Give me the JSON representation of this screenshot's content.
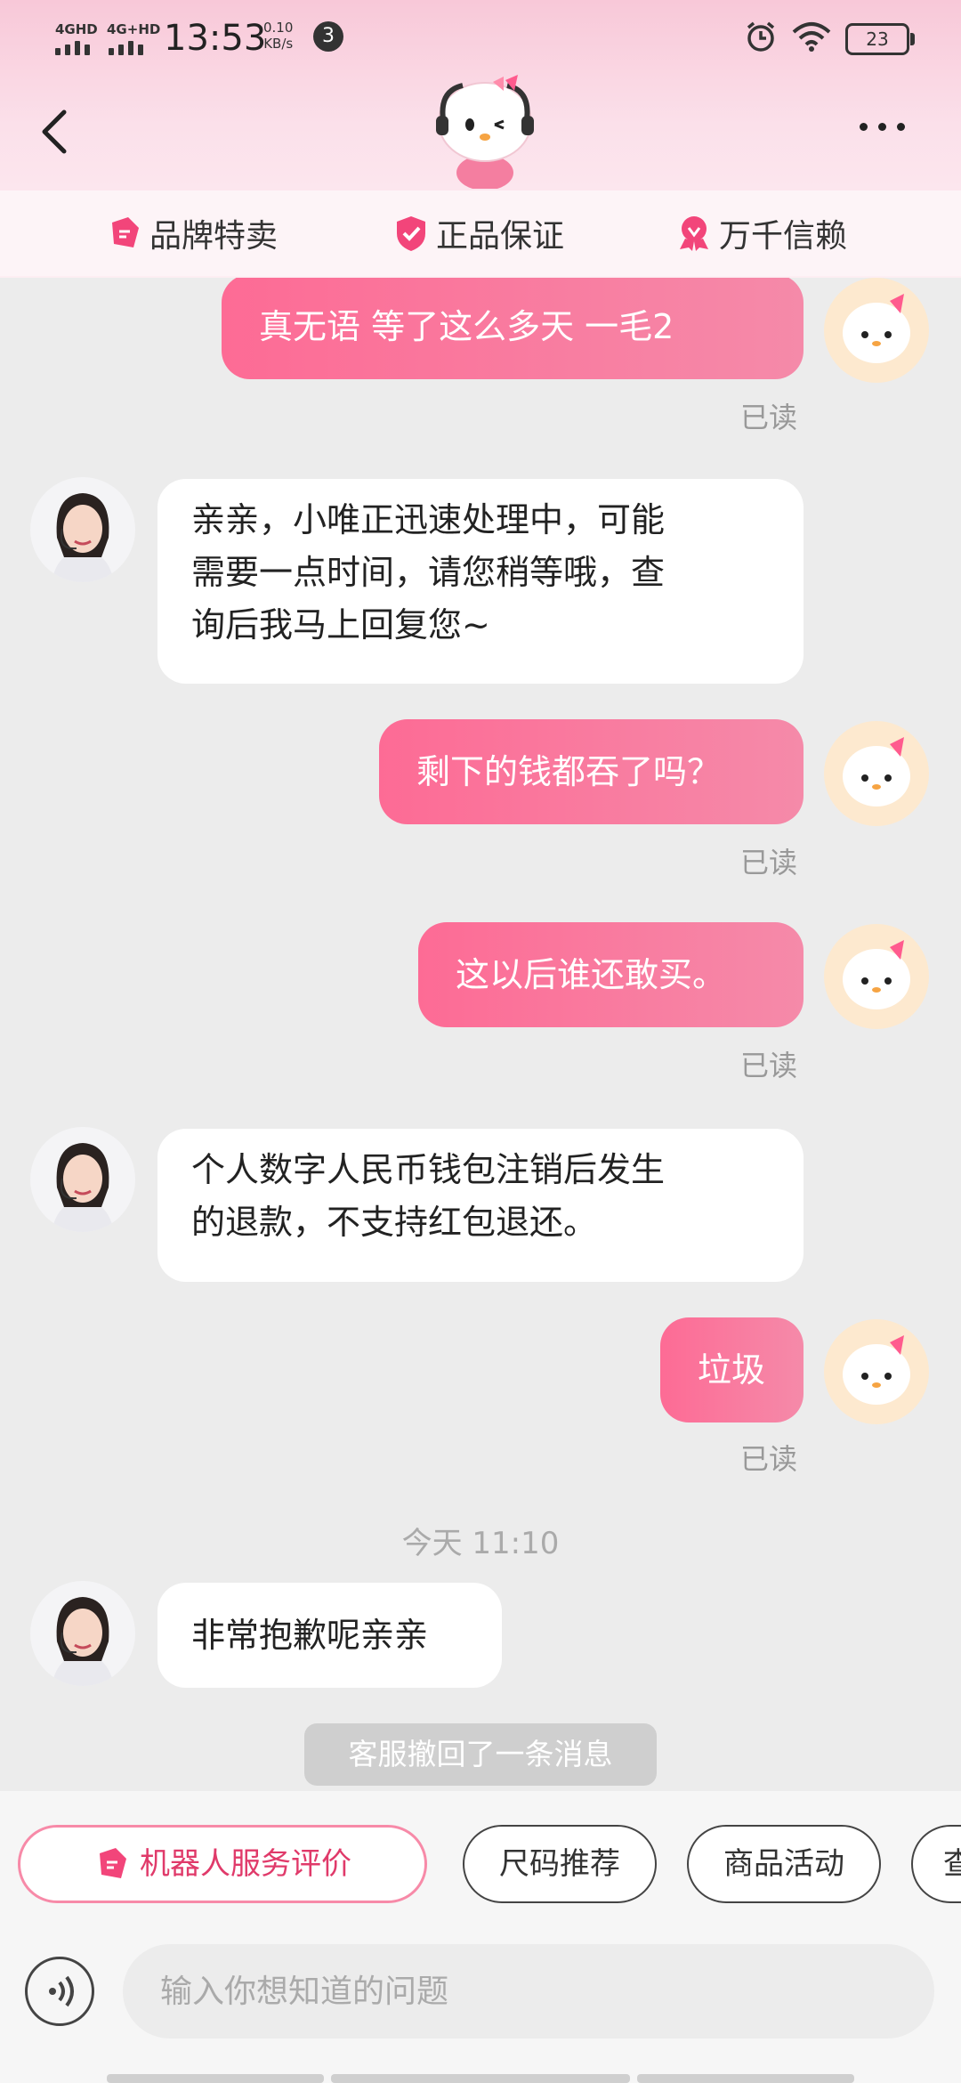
{
  "status_bar": {
    "network1": "4GHD",
    "network2": "4G+HD",
    "time": "13:53",
    "speed_value": "0.10",
    "speed_unit": "KB/s",
    "notification_count": "3",
    "battery": "23"
  },
  "header": {
    "guarantees": [
      {
        "label": "品牌特卖",
        "icon": "tag-icon"
      },
      {
        "label": "正品保证",
        "icon": "shield-check-icon"
      },
      {
        "label": "万千信赖",
        "icon": "heart-ribbon-icon"
      }
    ]
  },
  "messages": [
    {
      "type": "out",
      "text": "真无语   等了这么多天  一毛2",
      "read": "已读"
    },
    {
      "type": "in",
      "lines": [
        "亲亲，小唯正迅速处理中，可能",
        "需要一点时间，请您稍等哦，查",
        "询后我马上回复您~"
      ]
    },
    {
      "type": "out",
      "text": "剩下的钱都吞了吗？",
      "read": "已读"
    },
    {
      "type": "out",
      "text": "这以后谁还敢买。",
      "read": "已读"
    },
    {
      "type": "in",
      "lines": [
        "个人数字人民币钱包注销后发生",
        "的退款，不支持红包退还。"
      ]
    },
    {
      "type": "out",
      "text": "垃圾",
      "read": "已读"
    },
    {
      "type": "time",
      "text": "今天 11:10"
    },
    {
      "type": "in",
      "lines": [
        "非常抱歉呢亲亲"
      ]
    },
    {
      "type": "system",
      "text": "客服撤回了一条消息"
    }
  ],
  "quick_actions": [
    "机器人服务评价",
    "尺码推荐",
    "商品活动",
    "查"
  ],
  "input": {
    "placeholder": "输入你想知道的问题"
  },
  "colors": {
    "accent": "#fd6b95",
    "accent_light": "#f58aa9",
    "background": "#ececec"
  }
}
